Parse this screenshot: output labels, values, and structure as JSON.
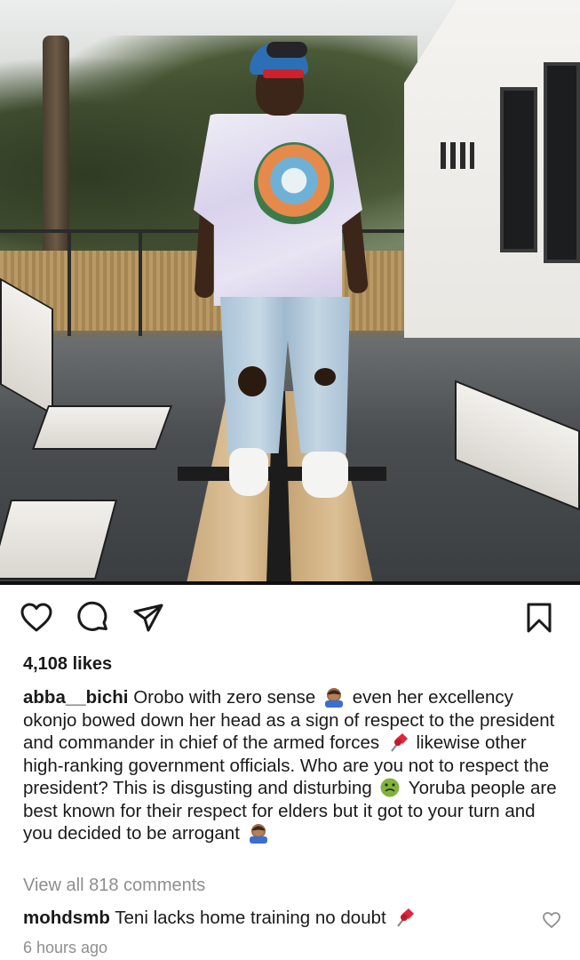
{
  "post": {
    "image_alt": "",
    "likes": "4,108 likes",
    "caption": {
      "username": "abba__bichi",
      "seg1": " Orobo with zero sense ",
      "seg2": " even her excellency okonjo bowed down her head as a sign of respect to the president and commander in chief of the armed forces ",
      "seg3": " likewise other high-ranking government officials. Who are you not to respect the president? This is disgusting and disturbing ",
      "seg4": " Yoruba people are best known for their respect for elders but it got to your turn and you decided to be arrogant ",
      "emojis": [
        "facepalm-emoji",
        "pushpin-emoji",
        "nauseated-face-emoji",
        "facepalm-emoji"
      ]
    },
    "view_all_comments": "View all 818 comments",
    "top_comment": {
      "username": "mohdsmb",
      "text": " Teni lacks home training no doubt ",
      "emoji": "pushpin-emoji"
    },
    "timestamp": "6 hours ago"
  },
  "icons": {
    "like": "heart-icon",
    "comment": "comment-icon",
    "share": "send-icon",
    "save": "bookmark-icon",
    "comment_like": "small-heart-icon"
  },
  "colors": {
    "text": "#262626",
    "muted": "#8e8e8e",
    "background": "#ffffff"
  }
}
